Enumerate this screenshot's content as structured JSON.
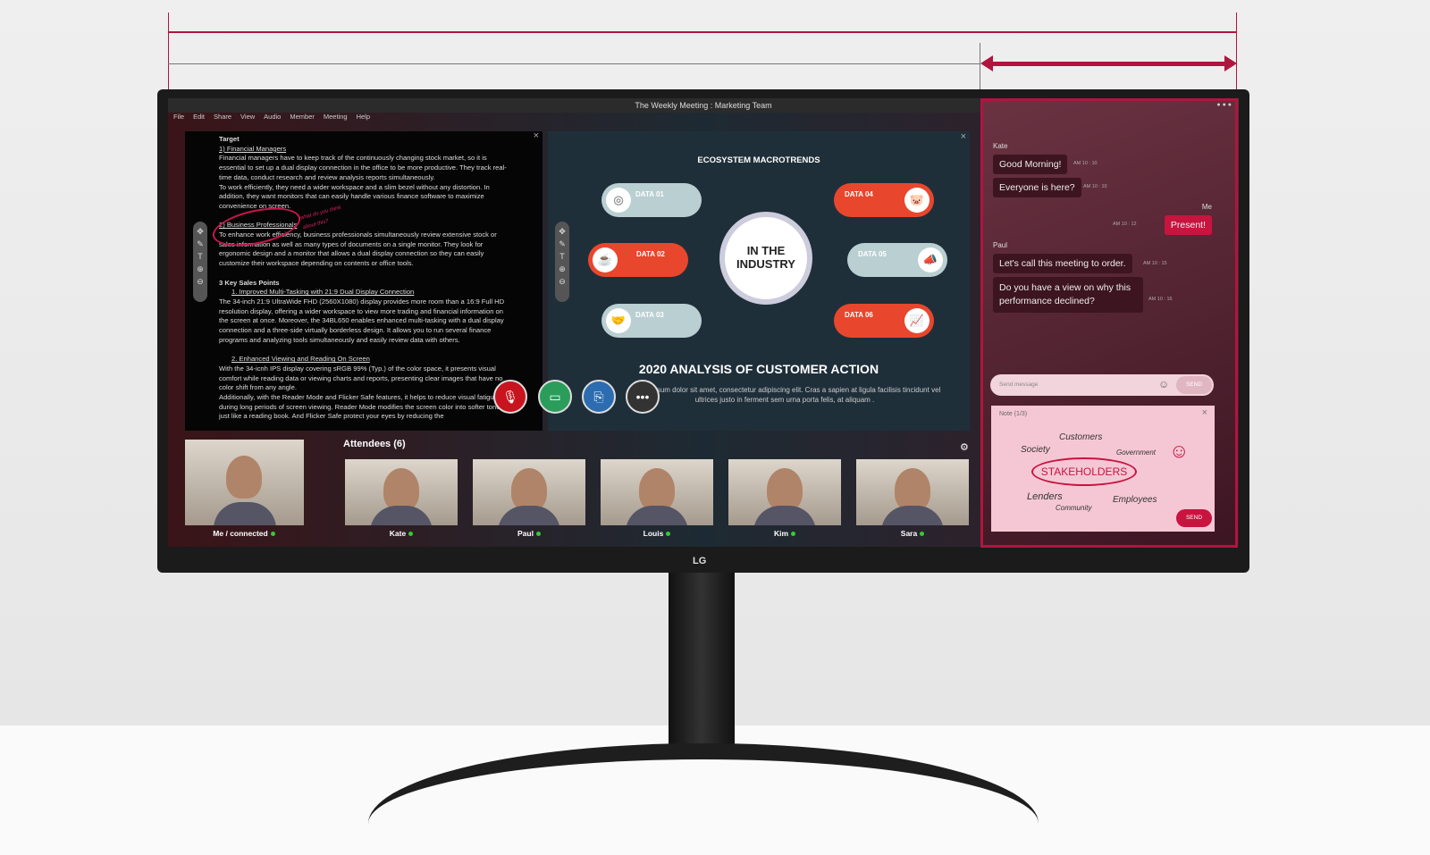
{
  "window": {
    "title": "The Weekly Meeting : Marketing Team",
    "menu": [
      "File",
      "Edit",
      "Share",
      "View",
      "Audio",
      "Member",
      "Meeting",
      "Help"
    ]
  },
  "doc": {
    "lines": [
      "Target",
      "1) Financial Managers",
      "Financial managers have to keep track of the continuously changing stock market, so it is essential to set up a dual display connection in the office to be more productive. They track real-time data, conduct research and review analysis reports simultaneously.",
      "To work efficiently, they need a wider workspace and a slim bezel without any distortion. In addition, they want monitors that can easily handle various finance software to maximize convenience on screen.",
      "2) Business Professionals",
      "To enhance work efficiency, business professionals simultaneously review extensive stock or sales information as well as many types of documents on a single monitor. They look for ergonomic design and a monitor that allows a dual display connection so they can easily customize their workspace depending on contents or office tools.",
      "3 Key Sales Points",
      "1.  Improved Multi-Tasking with 21:9 Dual Display Connection",
      "The 34-inch 21:9 UltraWide FHD (2560X1080) display provides more room than a 16:9 Full HD resolution display, offering a wider workspace to view more trading and financial information on the screen at once. Moreover, the 34BL650 enables enhanced multi-tasking with a dual display connection and a three-side virtually borderless design. It allows you to run several finance programs and analyzing tools simultaneously and easily review data with others.",
      "2.  Enhanced Viewing and Reading On Screen",
      "With the 34-icnh IPS display covering sRGB 99% (Typ.) of the color space, it presents visual comfort while reading data or viewing charts and reports, presenting clear images that have no color shift from any angle.",
      "Additionally, with the Reader Mode and Flicker Safe features, it helps to reduce visual fatigue during long periods of screen viewing. Reader Mode modifies the screen color into softer tones just like a reading book. And Flicker Safe protect your eyes by reducing the"
    ],
    "annotation": "what do you think about this?"
  },
  "slide": {
    "title": "ECOSYSTEM MACROTRENDS",
    "center": "IN THE INDUSTRY",
    "items": [
      "DATA 01",
      "DATA 02",
      "DATA 03",
      "DATA 04",
      "DATA 05",
      "DATA 06"
    ],
    "heading": "2020 ANALYSIS OF CUSTOMER ACTION",
    "body": "Lorem ipsum dolor sit amet, consectetur adipiscing elit. Cras a sapien at ligula facilisis tincidunt vel ultrices justo in ferment sem urna porta felis, at aliquam ."
  },
  "attendees": {
    "title": "Attendees (6)",
    "people": [
      "Me / connected",
      "Kate",
      "Paul",
      "Louis",
      "Kim",
      "Sara"
    ]
  },
  "chat": {
    "messages": [
      {
        "sender": "Kate",
        "text": "Good Morning!",
        "time": "AM 10 : 10"
      },
      {
        "text": "Everyone is here?",
        "time": "AM 10 : 10"
      },
      {
        "sender": "Me",
        "text": "Present!",
        "time": "AM 10 : 12"
      },
      {
        "sender": "Paul",
        "text": "Let's call this meeting to order.",
        "time": "AM 10 : 15"
      },
      {
        "text": "Do you have a view on why this performance  declined?",
        "time": "AM 10 : 16"
      }
    ],
    "placeholder": "Send message",
    "send": "SEND"
  },
  "note": {
    "title": "Note (1/3)",
    "words": [
      "Customers",
      "Society",
      "Government",
      "STAKEHOLDERS",
      "Lenders",
      "Community",
      "Employees"
    ],
    "send": "SEND"
  },
  "brand": "LG",
  "colors": {
    "accent": "#b0153f",
    "me_bubble": "#c8143f"
  }
}
